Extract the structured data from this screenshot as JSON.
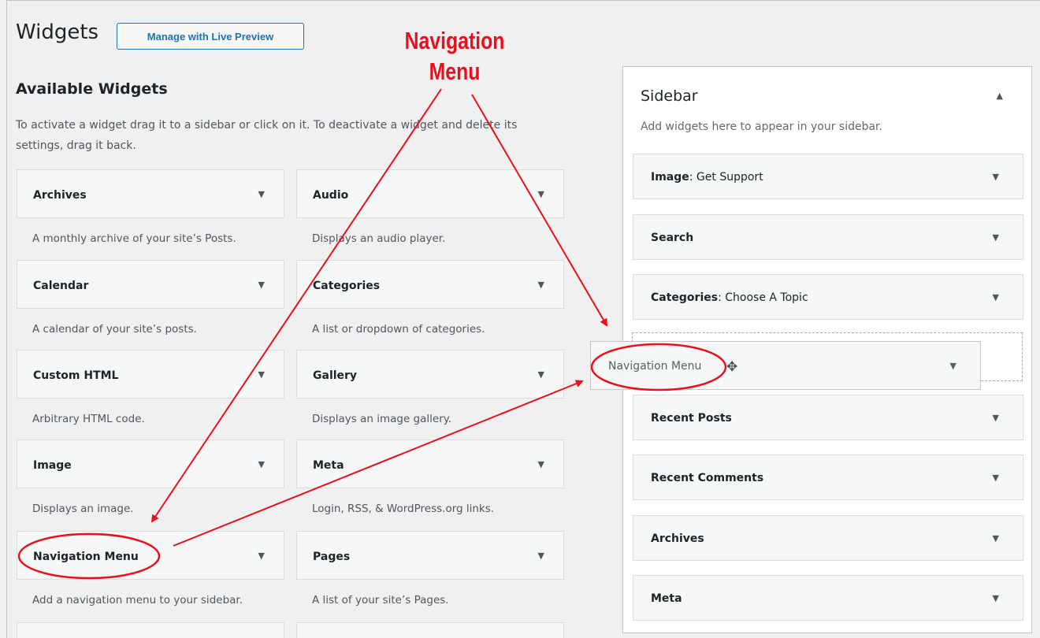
{
  "header": {
    "title": "Widgets",
    "live_preview_label": "Manage with Live Preview"
  },
  "available": {
    "title": "Available Widgets",
    "description": "To activate a widget drag it to a sidebar or click on it. To deactivate a widget and delete its settings, drag it back.",
    "widgets": [
      {
        "title": "Archives",
        "desc": "A monthly archive of your site’s Posts."
      },
      {
        "title": "Audio",
        "desc": "Displays an audio player."
      },
      {
        "title": "Calendar",
        "desc": "A calendar of your site’s posts."
      },
      {
        "title": "Categories",
        "desc": "A list or dropdown of categories."
      },
      {
        "title": "Custom HTML",
        "desc": "Arbitrary HTML code."
      },
      {
        "title": "Gallery",
        "desc": "Displays an image gallery."
      },
      {
        "title": "Image",
        "desc": "Displays an image."
      },
      {
        "title": "Meta",
        "desc": "Login, RSS, & WordPress.org links."
      },
      {
        "title": "Navigation Menu",
        "desc": "Add a navigation menu to your sidebar."
      },
      {
        "title": "Pages",
        "desc": "A list of your site’s Pages."
      }
    ]
  },
  "sidebar": {
    "title": "Sidebar",
    "description": "Add widgets here to appear in your sidebar.",
    "widgets": [
      {
        "title": "Image",
        "suffix": ": Get Support"
      },
      {
        "title": "Search",
        "suffix": ""
      },
      {
        "title": "Categories",
        "suffix": ": Choose A Topic"
      },
      {
        "title": "Recent Posts",
        "suffix": ""
      },
      {
        "title": "Recent Comments",
        "suffix": ""
      },
      {
        "title": "Archives",
        "suffix": ""
      },
      {
        "title": "Meta",
        "suffix": ""
      }
    ]
  },
  "dragging": {
    "title": "Navigation Menu"
  },
  "annotation": {
    "line1": "Navigation",
    "line2": "Menu",
    "color": "#e8101e"
  },
  "icons": {
    "collapse": "triangle-up-icon",
    "expand": "triangle-down-icon",
    "move": "move-cursor-icon"
  }
}
